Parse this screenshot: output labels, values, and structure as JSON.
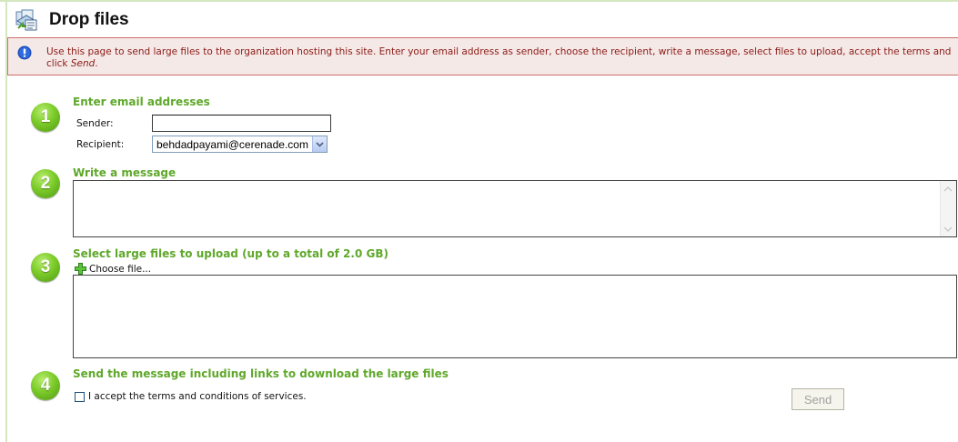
{
  "header": {
    "title": "Drop files",
    "icon": "drop-files-icon"
  },
  "notice": {
    "text_before": "Use this page to send large files to the organization hosting this site. Enter your email address as sender, choose the recipient, write a message, select files to upload, accept the terms and click ",
    "send_word": "Send",
    "text_after": ".",
    "icon": "info-icon"
  },
  "step1": {
    "number": "1",
    "title": "Enter email addresses",
    "sender_label": "Sender:",
    "sender_value": "",
    "recipient_label": "Recipient:",
    "recipient_value": "behdadpayami@cerenade.com"
  },
  "step2": {
    "number": "2",
    "title": "Write a message",
    "message_value": ""
  },
  "step3": {
    "number": "3",
    "title": "Select large files to upload (up to a total of 2.0 GB)",
    "choose_file_label": "Choose file..."
  },
  "step4": {
    "number": "4",
    "title": "Send the message including links to download the large files",
    "terms_label": "I accept the terms and conditions of services.",
    "send_label": "Send"
  },
  "colors": {
    "accent_green": "#5fa82a",
    "notice_bg": "#f5e9e8",
    "notice_border": "#cc6f6a",
    "notice_text": "#8a1a14"
  }
}
